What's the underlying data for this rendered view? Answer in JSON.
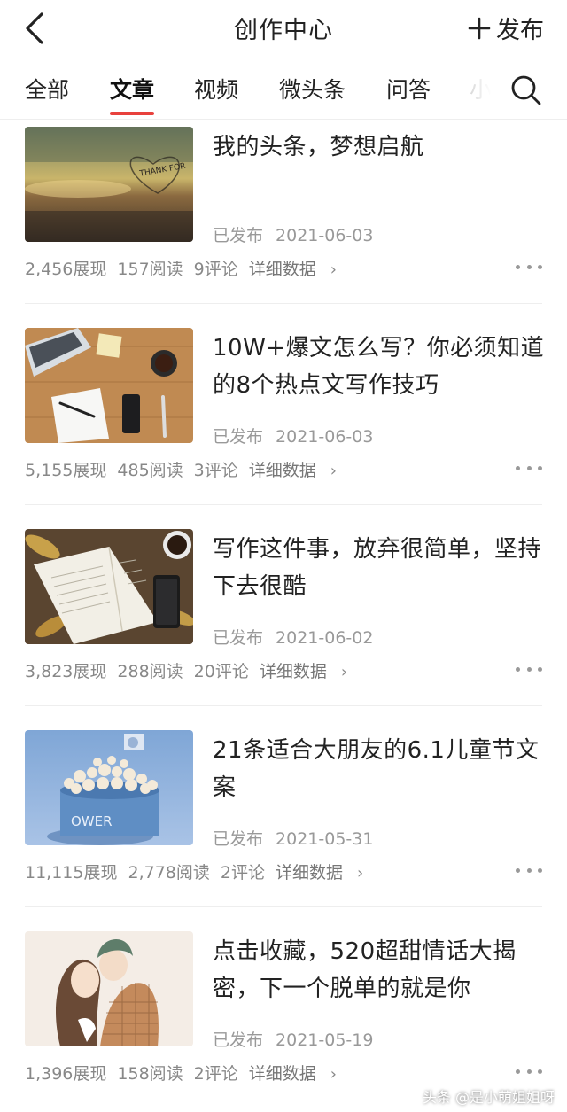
{
  "header": {
    "title": "创作中心",
    "publish_label": "发布",
    "back_icon": "chevron-left-icon",
    "publish_icon": "plus-icon"
  },
  "tabs": [
    {
      "label": "全部",
      "active": false
    },
    {
      "label": "文章",
      "active": true
    },
    {
      "label": "视频",
      "active": false
    },
    {
      "label": "微头条",
      "active": false
    },
    {
      "label": "问答",
      "active": false
    },
    {
      "label": "小",
      "active": false
    }
  ],
  "accent_color": "#e8413d",
  "articles": [
    {
      "title": "我的头条，梦想启航",
      "status": "已发布",
      "date": "2021-06-03",
      "impressions": "2,456展现",
      "reads": "157阅读",
      "comments": "9评论",
      "detail_label": "详细数据",
      "thumb_text": "THANK FOR"
    },
    {
      "title": "10W+爆文怎么写？你必须知道的8个热点文写作技巧",
      "status": "已发布",
      "date": "2021-06-03",
      "impressions": "5,155展现",
      "reads": "485阅读",
      "comments": "3评论",
      "detail_label": "详细数据"
    },
    {
      "title": "写作这件事，放弃很简单，坚持下去很酷",
      "status": "已发布",
      "date": "2021-06-02",
      "impressions": "3,823展现",
      "reads": "288阅读",
      "comments": "20评论",
      "detail_label": "详细数据"
    },
    {
      "title": "21条适合大朋友的6.1儿童节文案",
      "status": "已发布",
      "date": "2021-05-31",
      "impressions": "11,115展现",
      "reads": "2,778阅读",
      "comments": "2评论",
      "detail_label": "详细数据",
      "thumb_text": "OWER"
    },
    {
      "title": "点击收藏，520超甜情话大揭密，下一个脱单的就是你",
      "status": "已发布",
      "date": "2021-05-19",
      "impressions": "1,396展现",
      "reads": "158阅读",
      "comments": "2评论",
      "detail_label": "详细数据"
    }
  ],
  "watermark": "头条 @是小萌姐姐呀"
}
